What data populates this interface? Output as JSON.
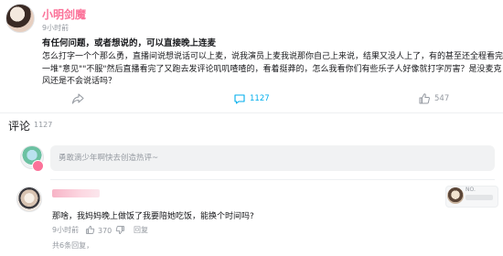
{
  "post": {
    "author": "小明剑魔",
    "time": "9小时前",
    "title": "有任何问题，或者想说的，可以直接晚上连麦",
    "content_lines": [
      "怎么打字一个个那么勇，直播间说想说话可以上麦，说我演员上麦我说那你自己上来说，结果又没人上了，有的甚至还全程看完",
      "一堆\"意见\"\"不服\"然后直播看完了又跑去发评论叽叽喳喳的，看着挺莽的，怎么我看你们有些乐子人好像就打字厉害？是没麦克",
      "风还是不会说话吗？"
    ],
    "share_icon": "share-icon",
    "comment_icon": "comment-icon",
    "comment_count": "1127",
    "like_icon": "thumb-up-icon",
    "like_count": "547"
  },
  "comments_section": {
    "title": "评论",
    "count": "1127",
    "input_placeholder": "勇敢滴少年啊快去创造热评~"
  },
  "comment": {
    "text": "那啥，我妈妈晚上做饭了我要陪她吃饭，能换个时间吗?",
    "time": "9小时前",
    "like_count": "370",
    "reply_label": "回复",
    "replies_link": "共6条回复，",
    "badge_no": "NO.",
    "colors": {
      "username": "#fb7299"
    }
  },
  "colors": {
    "accent": "#fb7299",
    "secondary_text": "#9499a0",
    "accent_blue": "#00aeec"
  }
}
